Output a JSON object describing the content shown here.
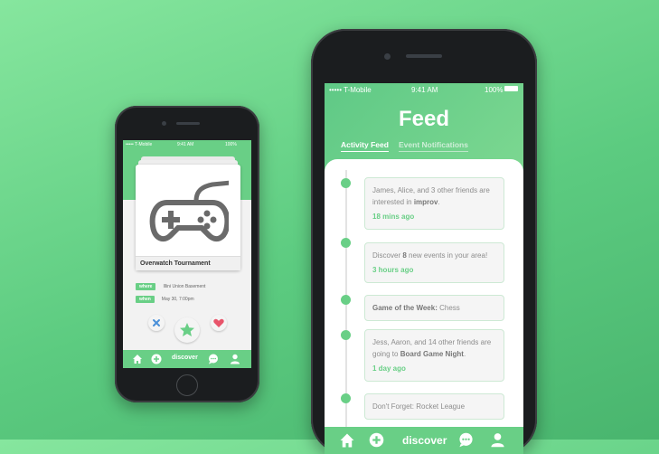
{
  "left_phone": {
    "status": {
      "carrier": "••••• T-Mobile",
      "time": "9:41 AM",
      "battery": "100%"
    },
    "card_title": "Overwatch Tournament",
    "where_label": "where",
    "where_value": "Illini Union Basement",
    "when_label": "when",
    "when_value": "May 30, 7:00pm",
    "nav_discover": "discover",
    "icons": [
      "gamepad-icon",
      "close-icon",
      "star-icon",
      "heart-icon",
      "home-icon",
      "plus-icon",
      "chat-icon",
      "user-icon"
    ]
  },
  "right_phone": {
    "status": {
      "carrier": "••••• T-Mobile",
      "time": "9:41 AM",
      "battery": "100%"
    },
    "title": "Feed",
    "tabs": [
      "Activity Feed",
      "Event Notifications"
    ],
    "feed": [
      {
        "pre": "James, Alice, and 3 other friends are interested in ",
        "bold": "improv",
        "post": ".",
        "time": "18 mins ago"
      },
      {
        "pre": "Discover ",
        "bold": "8",
        "post": " new events in your area!",
        "time": "3 hours ago"
      },
      {
        "pre": "",
        "bold": "Game of the Week:",
        "post": " Chess",
        "time": ""
      },
      {
        "pre": "Jess, Aaron, and 14 other friends are going to ",
        "bold": "Board Game Night",
        "post": ".",
        "time": "1 day ago"
      },
      {
        "pre": "Don't Forget: Rocket League",
        "bold": "",
        "post": "",
        "time": ""
      }
    ],
    "nav_discover": "discover"
  },
  "colors": {
    "accent": "#69cf86",
    "background": "#5ccb80",
    "phone_body": "#1b1d1f"
  }
}
